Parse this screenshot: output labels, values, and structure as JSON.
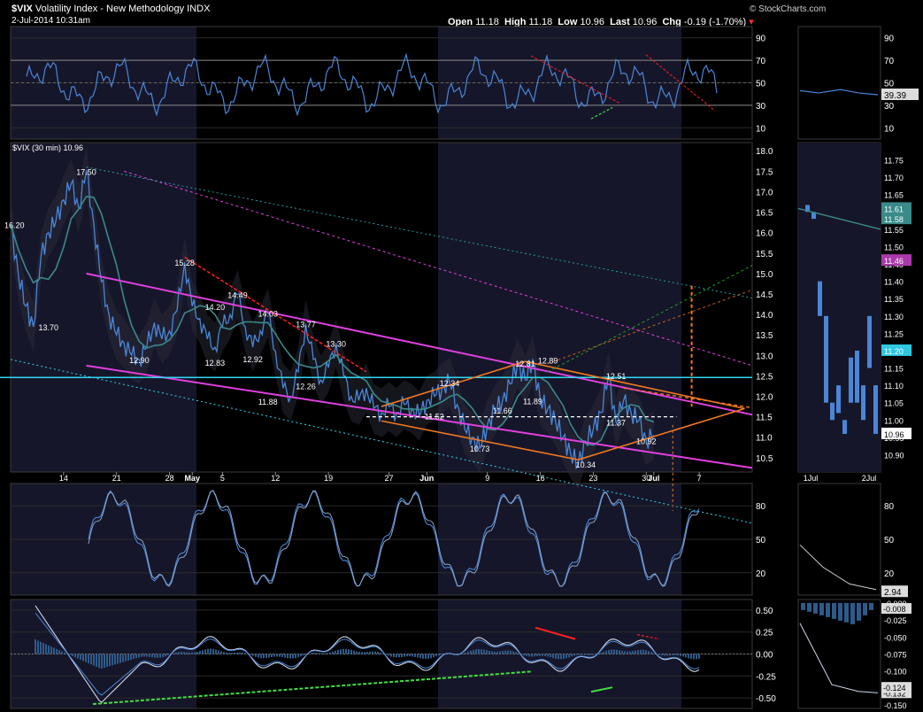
{
  "header": {
    "symbol": "$VIX",
    "name": "Volatility Index - New Methodology",
    "exchange": "INDX",
    "datetime": "2-Jul-2014 10:31am",
    "open_label": "Open",
    "open": "11.18",
    "high_label": "High",
    "high": "11.18",
    "low_label": "Low",
    "low": "10.96",
    "last_label": "Last",
    "last": "10.96",
    "chg_label": "Chg",
    "chg": "-0.19 (-1.70%)",
    "watermark": "© StockCharts.com"
  },
  "colors": {
    "background": "#000000",
    "shade": "#16162a",
    "price": "#4a86d8",
    "magenta": "#e040e0",
    "orange": "#f07820",
    "cyan": "#30d8f0",
    "red": "#ff2020",
    "green": "#40e040",
    "axis_text": "#ffffff"
  },
  "chart_data": [
    {
      "type": "line",
      "panel": "RSI",
      "y_ticks": [
        10,
        30,
        50,
        70,
        90
      ],
      "ylim": [
        0,
        100
      ],
      "right_panel_labels": [
        "39.39"
      ]
    },
    {
      "type": "line",
      "panel": "price",
      "legend": "$VIX (30 min) 10.96",
      "ylim": [
        10.15,
        18.2
      ],
      "y_ticks": [
        "10.5",
        "11.0",
        "11.5",
        "12.0",
        "12.5",
        "13.0",
        "13.5",
        "14.0",
        "14.5",
        "15.0",
        "15.5",
        "16.0",
        "16.5",
        "17.0",
        "17.5",
        "18.0"
      ],
      "x_ticks": [
        "14",
        "21",
        "28",
        "May",
        "5",
        "12",
        "19",
        "27",
        "Jun",
        "9",
        "16",
        "23",
        "30",
        "Jul",
        "7"
      ],
      "x_tick_days": [
        0,
        7,
        14,
        17,
        21,
        28,
        35,
        43,
        48,
        56,
        63,
        70,
        77,
        78,
        84
      ],
      "x_span_days": [
        -7,
        91
      ],
      "annotations": [
        {
          "label": "16.20",
          "day": -6.5,
          "value": 16.2
        },
        {
          "label": "17.50",
          "day": 3,
          "value": 17.5
        },
        {
          "label": "13.70",
          "day": -2,
          "value": 13.7
        },
        {
          "label": "12.90",
          "day": 10,
          "value": 12.9
        },
        {
          "label": "15.28",
          "day": 16,
          "value": 15.28
        },
        {
          "label": "14.20",
          "day": 20,
          "value": 14.2
        },
        {
          "label": "12.83",
          "day": 20,
          "value": 12.83
        },
        {
          "label": "14.49",
          "day": 23,
          "value": 14.49
        },
        {
          "label": "12.92",
          "day": 25,
          "value": 12.92
        },
        {
          "label": "14.03",
          "day": 27,
          "value": 14.03
        },
        {
          "label": "11.88",
          "day": 27,
          "value": 11.88
        },
        {
          "label": "13.77",
          "day": 32,
          "value": 13.77
        },
        {
          "label": "12.26",
          "day": 32,
          "value": 12.26
        },
        {
          "label": "13.30",
          "day": 36,
          "value": 13.3
        },
        {
          "label": "11.52",
          "day": 49,
          "value": 11.52
        },
        {
          "label": "12.34",
          "day": 51,
          "value": 12.34
        },
        {
          "label": "10.73",
          "day": 55,
          "value": 10.73
        },
        {
          "label": "11.66",
          "day": 58,
          "value": 11.66
        },
        {
          "label": "12.81",
          "day": 61,
          "value": 12.81
        },
        {
          "label": "12.89",
          "day": 64,
          "value": 12.89
        },
        {
          "label": "11.89",
          "day": 62,
          "value": 11.89
        },
        {
          "label": "10.34",
          "day": 69,
          "value": 10.34
        },
        {
          "label": "12.51",
          "day": 73,
          "value": 12.51
        },
        {
          "label": "11.37",
          "day": 73,
          "value": 11.37
        },
        {
          "label": "10.92",
          "day": 77,
          "value": 10.92
        }
      ],
      "price_path": [
        [
          -7,
          16.2
        ],
        [
          -6,
          15.0
        ],
        [
          -5,
          14.2
        ],
        [
          -4,
          13.7
        ],
        [
          -3,
          15.4
        ],
        [
          -2,
          16.0
        ],
        [
          -1,
          16.3
        ],
        [
          0,
          16.8
        ],
        [
          1,
          17.2
        ],
        [
          2,
          16.6
        ],
        [
          3,
          17.5
        ],
        [
          4,
          16.2
        ],
        [
          5,
          14.8
        ],
        [
          6,
          14.0
        ],
        [
          7,
          13.5
        ],
        [
          8,
          13.3
        ],
        [
          9,
          13.0
        ],
        [
          10,
          12.9
        ],
        [
          11,
          13.2
        ],
        [
          12,
          13.8
        ],
        [
          13,
          13.4
        ],
        [
          14,
          13.6
        ],
        [
          15,
          14.1
        ],
        [
          16,
          15.28
        ],
        [
          17,
          14.2
        ],
        [
          18,
          13.9
        ],
        [
          19,
          13.4
        ],
        [
          20,
          13.2
        ],
        [
          21,
          13.7
        ],
        [
          22,
          14.0
        ],
        [
          23,
          14.49
        ],
        [
          24,
          13.7
        ],
        [
          25,
          13.2
        ],
        [
          26,
          13.6
        ],
        [
          27,
          14.03
        ],
        [
          28,
          13.1
        ],
        [
          29,
          12.2
        ],
        [
          30,
          12.0
        ],
        [
          31,
          12.6
        ],
        [
          32,
          13.77
        ],
        [
          33,
          12.9
        ],
        [
          34,
          12.4
        ],
        [
          35,
          12.7
        ],
        [
          36,
          13.3
        ],
        [
          37,
          12.5
        ],
        [
          38,
          12.0
        ],
        [
          39,
          11.9
        ],
        [
          40,
          12.2
        ],
        [
          41,
          11.7
        ],
        [
          42,
          11.6
        ],
        [
          43,
          11.75
        ],
        [
          44,
          11.6
        ],
        [
          45,
          11.8
        ],
        [
          46,
          11.7
        ],
        [
          47,
          11.52
        ],
        [
          48,
          11.9
        ],
        [
          49,
          12.0
        ],
        [
          50,
          12.2
        ],
        [
          51,
          12.34
        ],
        [
          52,
          11.8
        ],
        [
          53,
          11.2
        ],
        [
          54,
          11.0
        ],
        [
          55,
          10.73
        ],
        [
          56,
          11.3
        ],
        [
          57,
          11.66
        ],
        [
          58,
          11.9
        ],
        [
          59,
          12.3
        ],
        [
          60,
          12.81
        ],
        [
          61,
          12.4
        ],
        [
          62,
          12.89
        ],
        [
          63,
          11.89
        ],
        [
          64,
          11.7
        ],
        [
          65,
          11.4
        ],
        [
          66,
          11.0
        ],
        [
          67,
          10.6
        ],
        [
          68,
          10.34
        ],
        [
          69,
          10.9
        ],
        [
          70,
          11.2
        ],
        [
          71,
          11.6
        ],
        [
          72,
          12.51
        ],
        [
          73,
          11.37
        ],
        [
          74,
          11.9
        ],
        [
          75,
          11.6
        ],
        [
          76,
          11.4
        ],
        [
          77,
          10.92
        ],
        [
          78,
          11.05
        ]
      ],
      "right_panel": {
        "ylim": [
          10.85,
          11.8
        ],
        "y_ticks": [
          "10.90",
          "10.95",
          "11.00",
          "11.05",
          "11.10",
          "11.15",
          "11.20",
          "11.25",
          "11.30",
          "11.35",
          "11.40",
          "11.45",
          "11.50",
          "11.55",
          "11.60",
          "11.65",
          "11.70",
          "11.75"
        ],
        "x_ticks": [
          "1Jul",
          "2Jul"
        ],
        "value_labels": [
          "11.61",
          "11.58",
          "11.46",
          "11.20",
          "10.96"
        ]
      }
    },
    {
      "type": "line",
      "panel": "Stochastic",
      "y_ticks": [
        20,
        50,
        80
      ],
      "ylim": [
        0,
        100
      ],
      "right_panel_labels": [
        "2.94"
      ]
    },
    {
      "type": "line",
      "panel": "MACD",
      "y_ticks": [
        "0.50",
        "0.25",
        "0.00",
        "-0.25",
        "-0.50"
      ],
      "ylim": [
        -0.62,
        0.62
      ],
      "right_panel": {
        "y_ticks": [
          "-0.000",
          "-0.025",
          "-0.050",
          "-0.075",
          "-0.100",
          "-0.125",
          "-0.150"
        ],
        "value_labels": [
          "-0.008",
          "-0.132",
          "-0.124"
        ]
      }
    }
  ]
}
